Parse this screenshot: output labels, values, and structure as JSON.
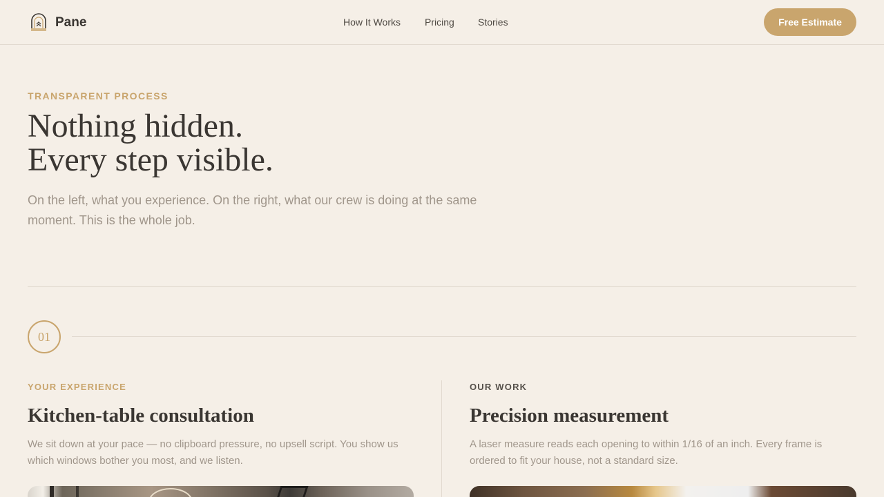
{
  "header": {
    "brand": "Pane",
    "nav": [
      "How It Works",
      "Pricing",
      "Stories"
    ],
    "cta_label": "Free Estimate"
  },
  "hero": {
    "eyebrow": "TRANSPARENT PROCESS",
    "title_line1": "Nothing hidden.",
    "title_line2": "Every step visible.",
    "subtitle": "On the left, what you experience. On the right, what our crew is doing at the same moment. This is the whole job."
  },
  "step": {
    "number": "01",
    "left": {
      "label": "YOUR EXPERIENCE",
      "title": "Kitchen-table consultation",
      "body": "We sit down at your pace — no clipboard pressure, no upsell script. You show us which windows bother you most, and we listen."
    },
    "right": {
      "label": "OUR WORK",
      "title": "Precision measurement",
      "body": "A laser measure reads each opening to within 1/16 of an inch. Every frame is ordered to fit your house, not a standard size."
    }
  },
  "colors": {
    "background": "#f5efe7",
    "accent": "#c9a56d",
    "text": "#3a3632",
    "muted": "#a0968b"
  },
  "icons": {
    "logo": "window-arch-logo-icon"
  }
}
